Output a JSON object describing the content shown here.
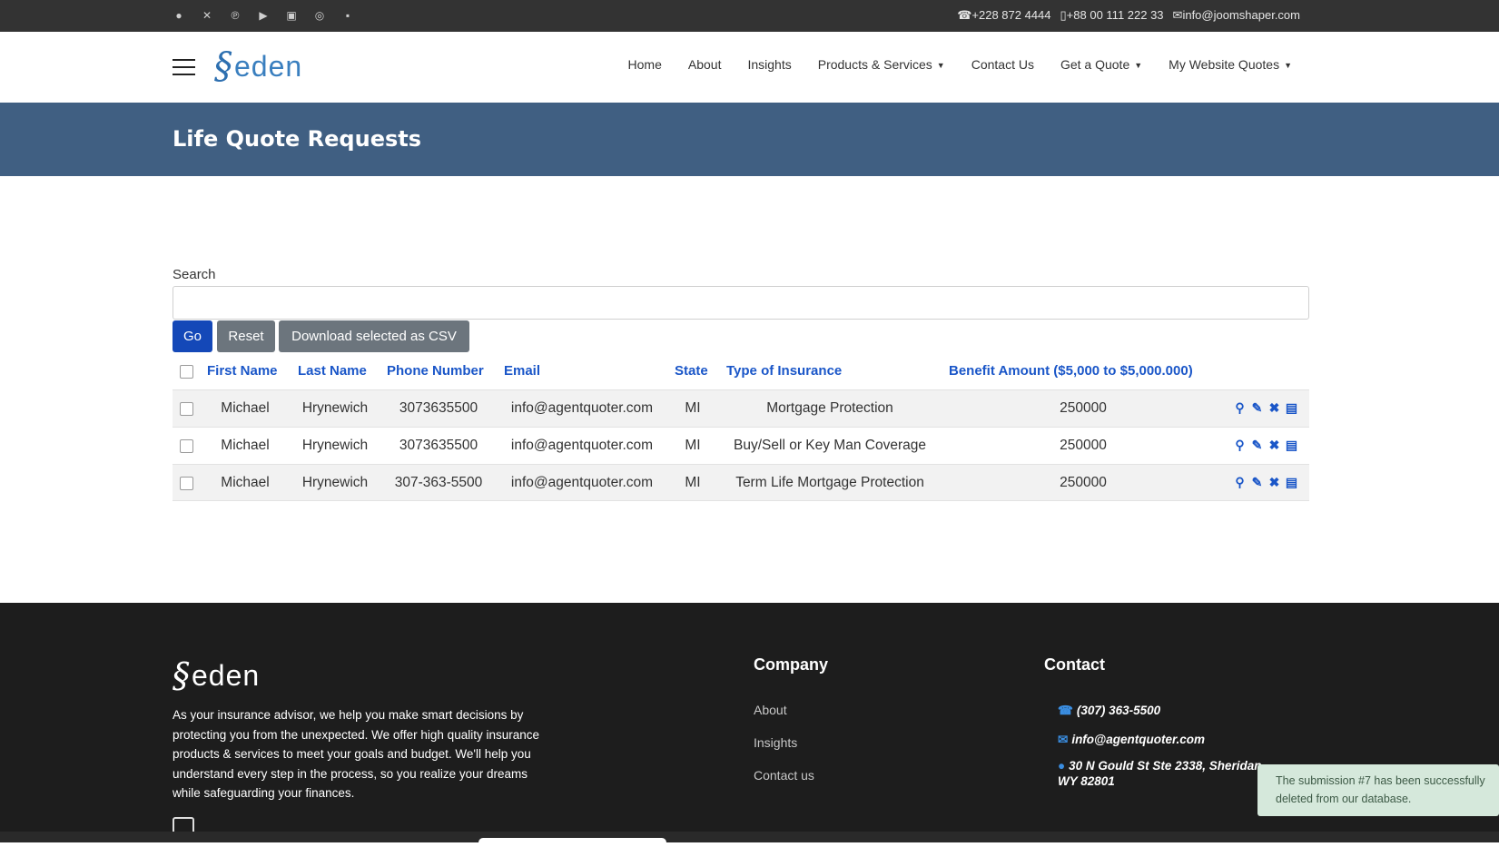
{
  "topbar": {
    "social_icons": [
      "facebook-icon",
      "x-icon",
      "pinterest-icon",
      "youtube-icon",
      "linkedin-icon",
      "instagram-icon",
      "flickr-icon"
    ],
    "phone": "+228 872 4444",
    "mobile": "+88 00 111 222 33",
    "email": "info@joomshaper.com"
  },
  "header": {
    "logo_text": "eden",
    "nav": [
      {
        "label": "Home",
        "dropdown": false
      },
      {
        "label": "About",
        "dropdown": false
      },
      {
        "label": "Insights",
        "dropdown": false
      },
      {
        "label": "Products & Services",
        "dropdown": true
      },
      {
        "label": "Contact Us",
        "dropdown": false
      },
      {
        "label": "Get a Quote",
        "dropdown": true
      },
      {
        "label": "My Website Quotes",
        "dropdown": true
      }
    ]
  },
  "banner": {
    "title": "Life Quote Requests"
  },
  "search": {
    "label": "Search",
    "value": "",
    "go_label": "Go",
    "reset_label": "Reset",
    "csv_label": "Download selected as CSV"
  },
  "table": {
    "columns": [
      "First Name",
      "Last Name",
      "Phone Number",
      "Email",
      "State",
      "Type of Insurance",
      "Benefit Amount ($5,000 to $5,000.000)"
    ],
    "rows": [
      {
        "first": "Michael",
        "last": "Hrynewich",
        "phone": "3073635500",
        "email": "info@agentquoter.com",
        "state": "MI",
        "type": "Mortgage Protection",
        "amount": "250000"
      },
      {
        "first": "Michael",
        "last": "Hrynewich",
        "phone": "3073635500",
        "email": "info@agentquoter.com",
        "state": "MI",
        "type": "Buy/Sell or Key Man Coverage",
        "amount": "250000"
      },
      {
        "first": "Michael",
        "last": "Hrynewich",
        "phone": "307-363-5500",
        "email": "info@agentquoter.com",
        "state": "MI",
        "type": "Term Life Mortgage Protection",
        "amount": "250000"
      }
    ]
  },
  "footer": {
    "logo_text": "eden",
    "description": "As your insurance advisor, we help you make smart decisions by protecting you from the unexpected. We offer high quality insurance products & services to meet your goals and budget. We'll help you understand every step in the process, so you realize your dreams while safeguarding your finances.",
    "company_title": "Company",
    "company_links": [
      "About",
      "Insights",
      "Contact us"
    ],
    "contact_title": "Contact",
    "contact_phone": "(307) 363-5500",
    "contact_email": "info@agentquoter.com",
    "contact_address": "30 N Gould St Ste 2338, Sheridan, WY 82801"
  },
  "toast": {
    "message": "The submission #7 has been successfully deleted from our database."
  },
  "colors": {
    "accent": "#1a56c8",
    "banner": "#405f82",
    "footer": "#1d1d1d",
    "topbar": "#333333"
  }
}
